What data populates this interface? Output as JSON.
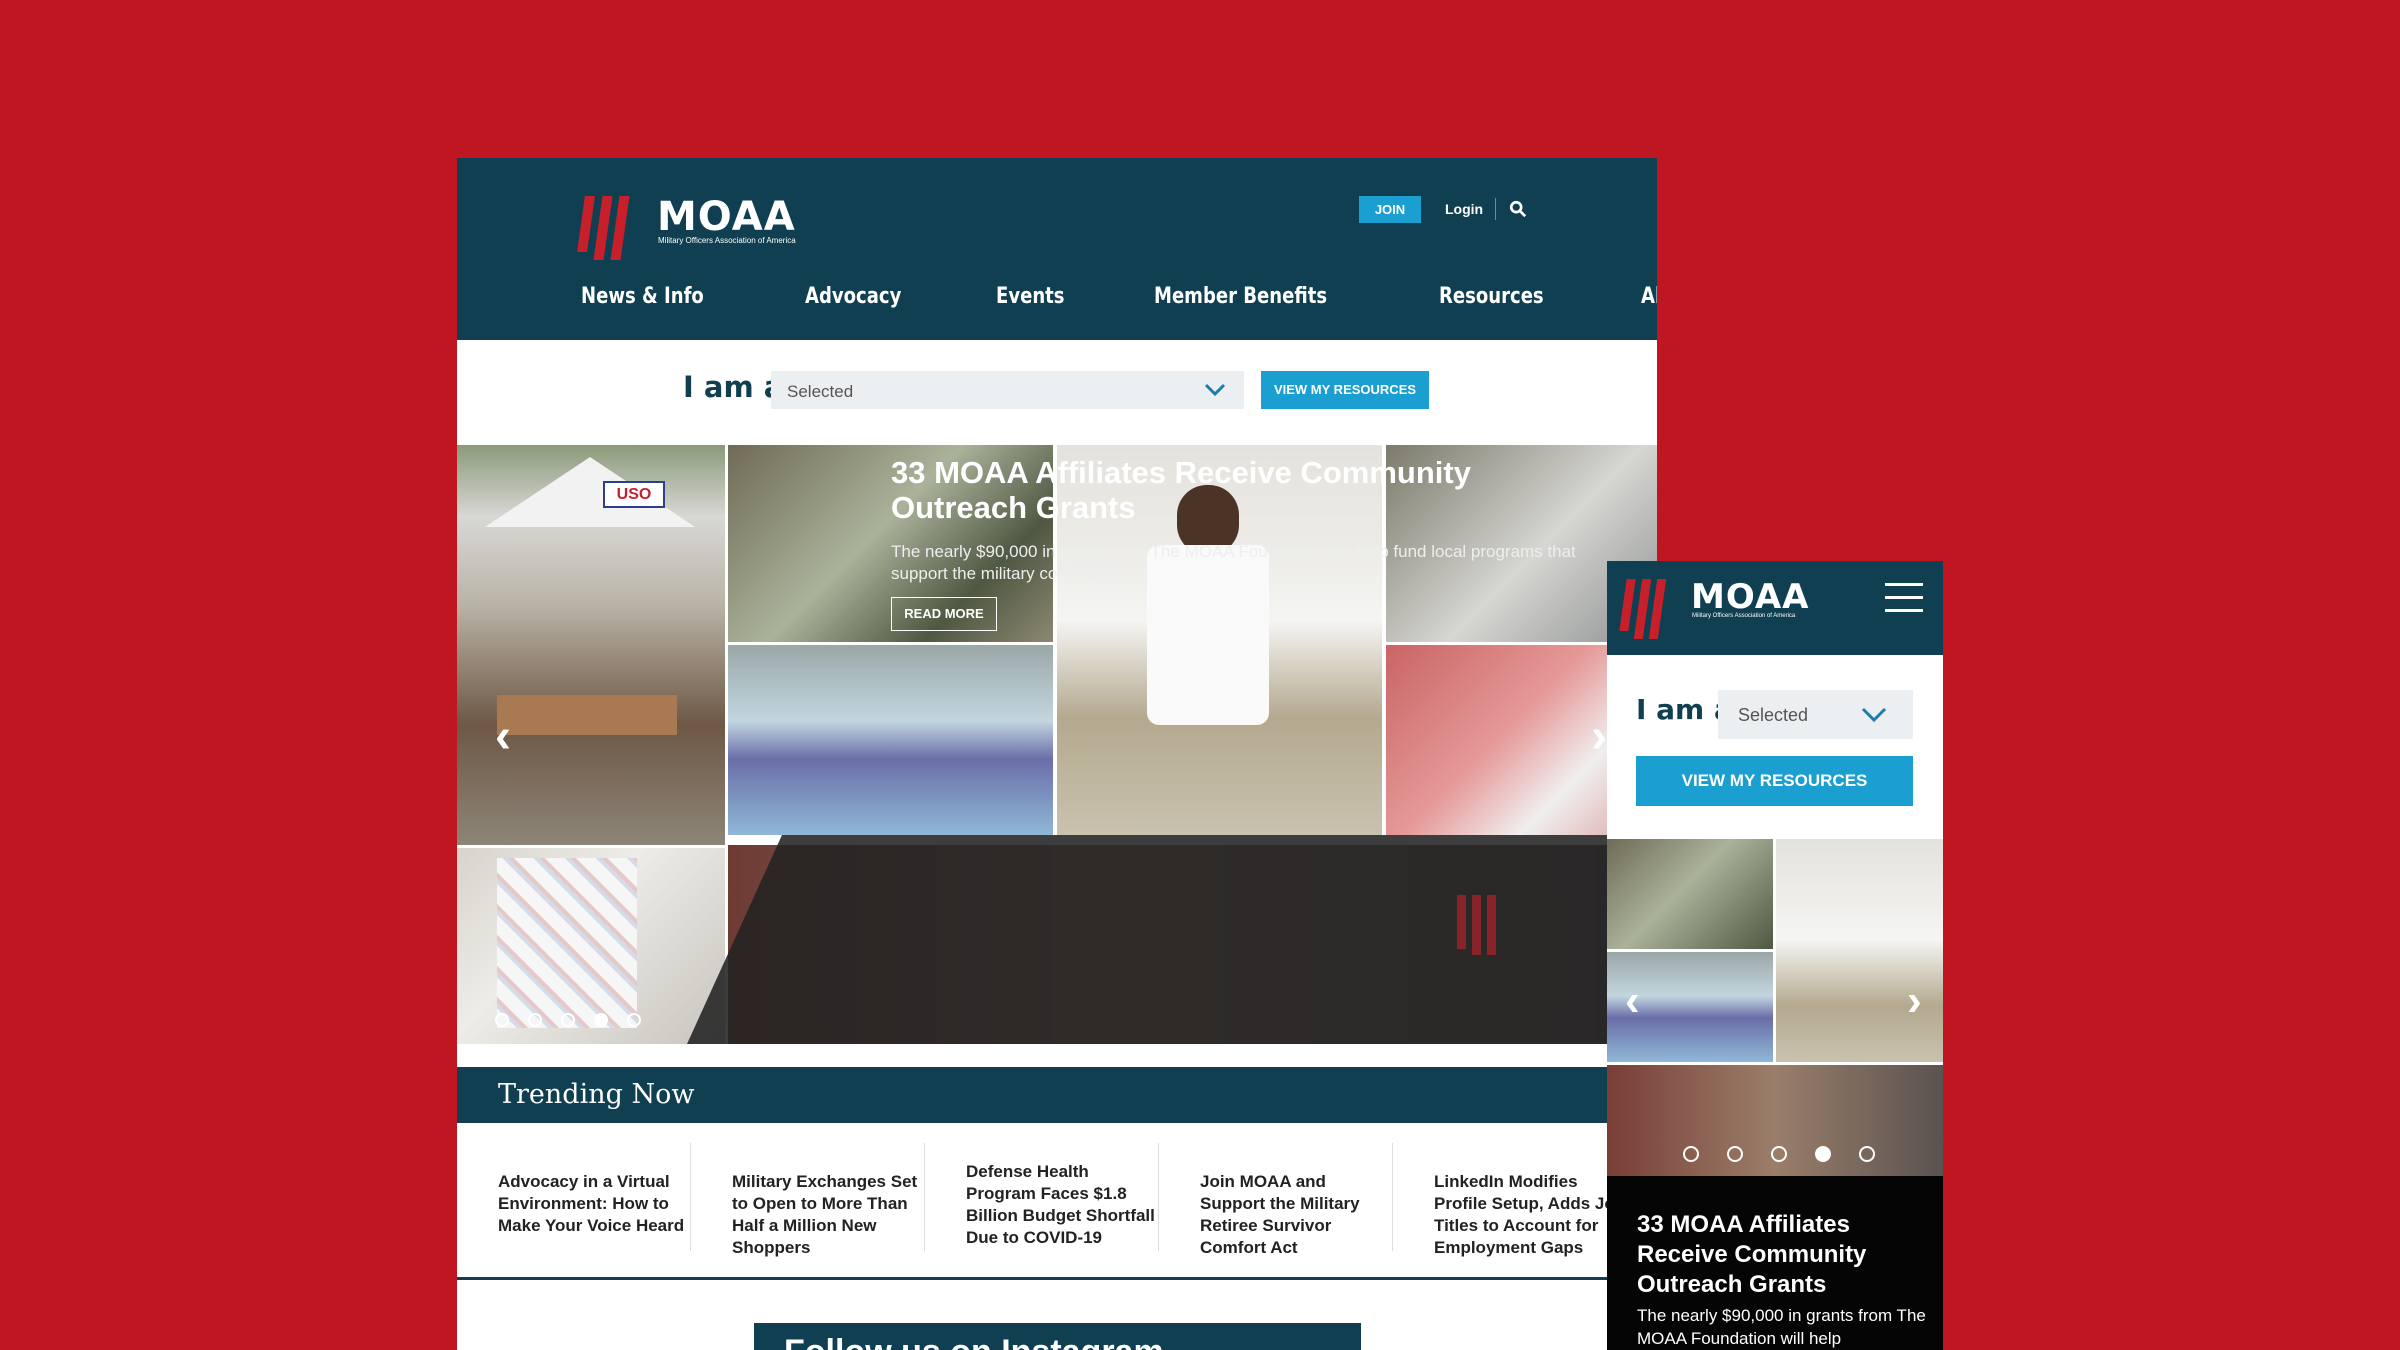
{
  "desktop": {
    "logo": {
      "word": "MOAA",
      "tagline": "Military Officers Association of America"
    },
    "utility": {
      "join_label": "JOIN",
      "login_label": "Login"
    },
    "nav": [
      "News & Info",
      "Advocacy",
      "Events",
      "Member Benefits",
      "Resources",
      "About MOAA"
    ],
    "selector": {
      "prefix": "I am a",
      "value": "Selected",
      "button": "VIEW MY RESOURCES"
    },
    "hero": {
      "title": "33 MOAA Affiliates Receive Community Outreach Grants",
      "description": "The nearly $90,000 in grants from The MOAA Foundation will help fund local programs that support the military community.",
      "cta": "READ MORE",
      "tent_sign": "USO",
      "slides": 5,
      "active_slide": 4
    },
    "trending": {
      "title": "Trending Now",
      "items": [
        "Advocacy in a Virtual Environment: How to Make Your Voice Heard",
        "Military Exchanges Set to Open to More Than Half a Million New Shoppers",
        "Defense Health Program Faces $1.8 Billion Budget Shortfall Due to COVID-19",
        "Join MOAA and Support the Military Retiree Survivor Comfort Act",
        "LinkedIn Modifies Profile Setup, Adds Job Titles to Account for Employment Gaps"
      ]
    },
    "instagram_banner": "Follow us on Instagram"
  },
  "mobile": {
    "logo": {
      "word": "MOAA",
      "tagline": "Military Officers Association of America"
    },
    "selector": {
      "prefix": "I am a",
      "value": "Selected",
      "button": "VIEW MY RESOURCES"
    },
    "hero": {
      "title": "33 MOAA Affiliates Receive Community Outreach Grants",
      "description": "The nearly $90,000 in grants from The MOAA Foundation will help"
    }
  },
  "colors": {
    "background": "#bf1622",
    "navy": "#0f3f50",
    "accent": "#1a9fd0",
    "brand_red": "#c7202b"
  },
  "icons": [
    "search-icon",
    "chevron-down-icon",
    "chevron-left-icon",
    "chevron-right-icon",
    "hamburger-menu-icon"
  ]
}
